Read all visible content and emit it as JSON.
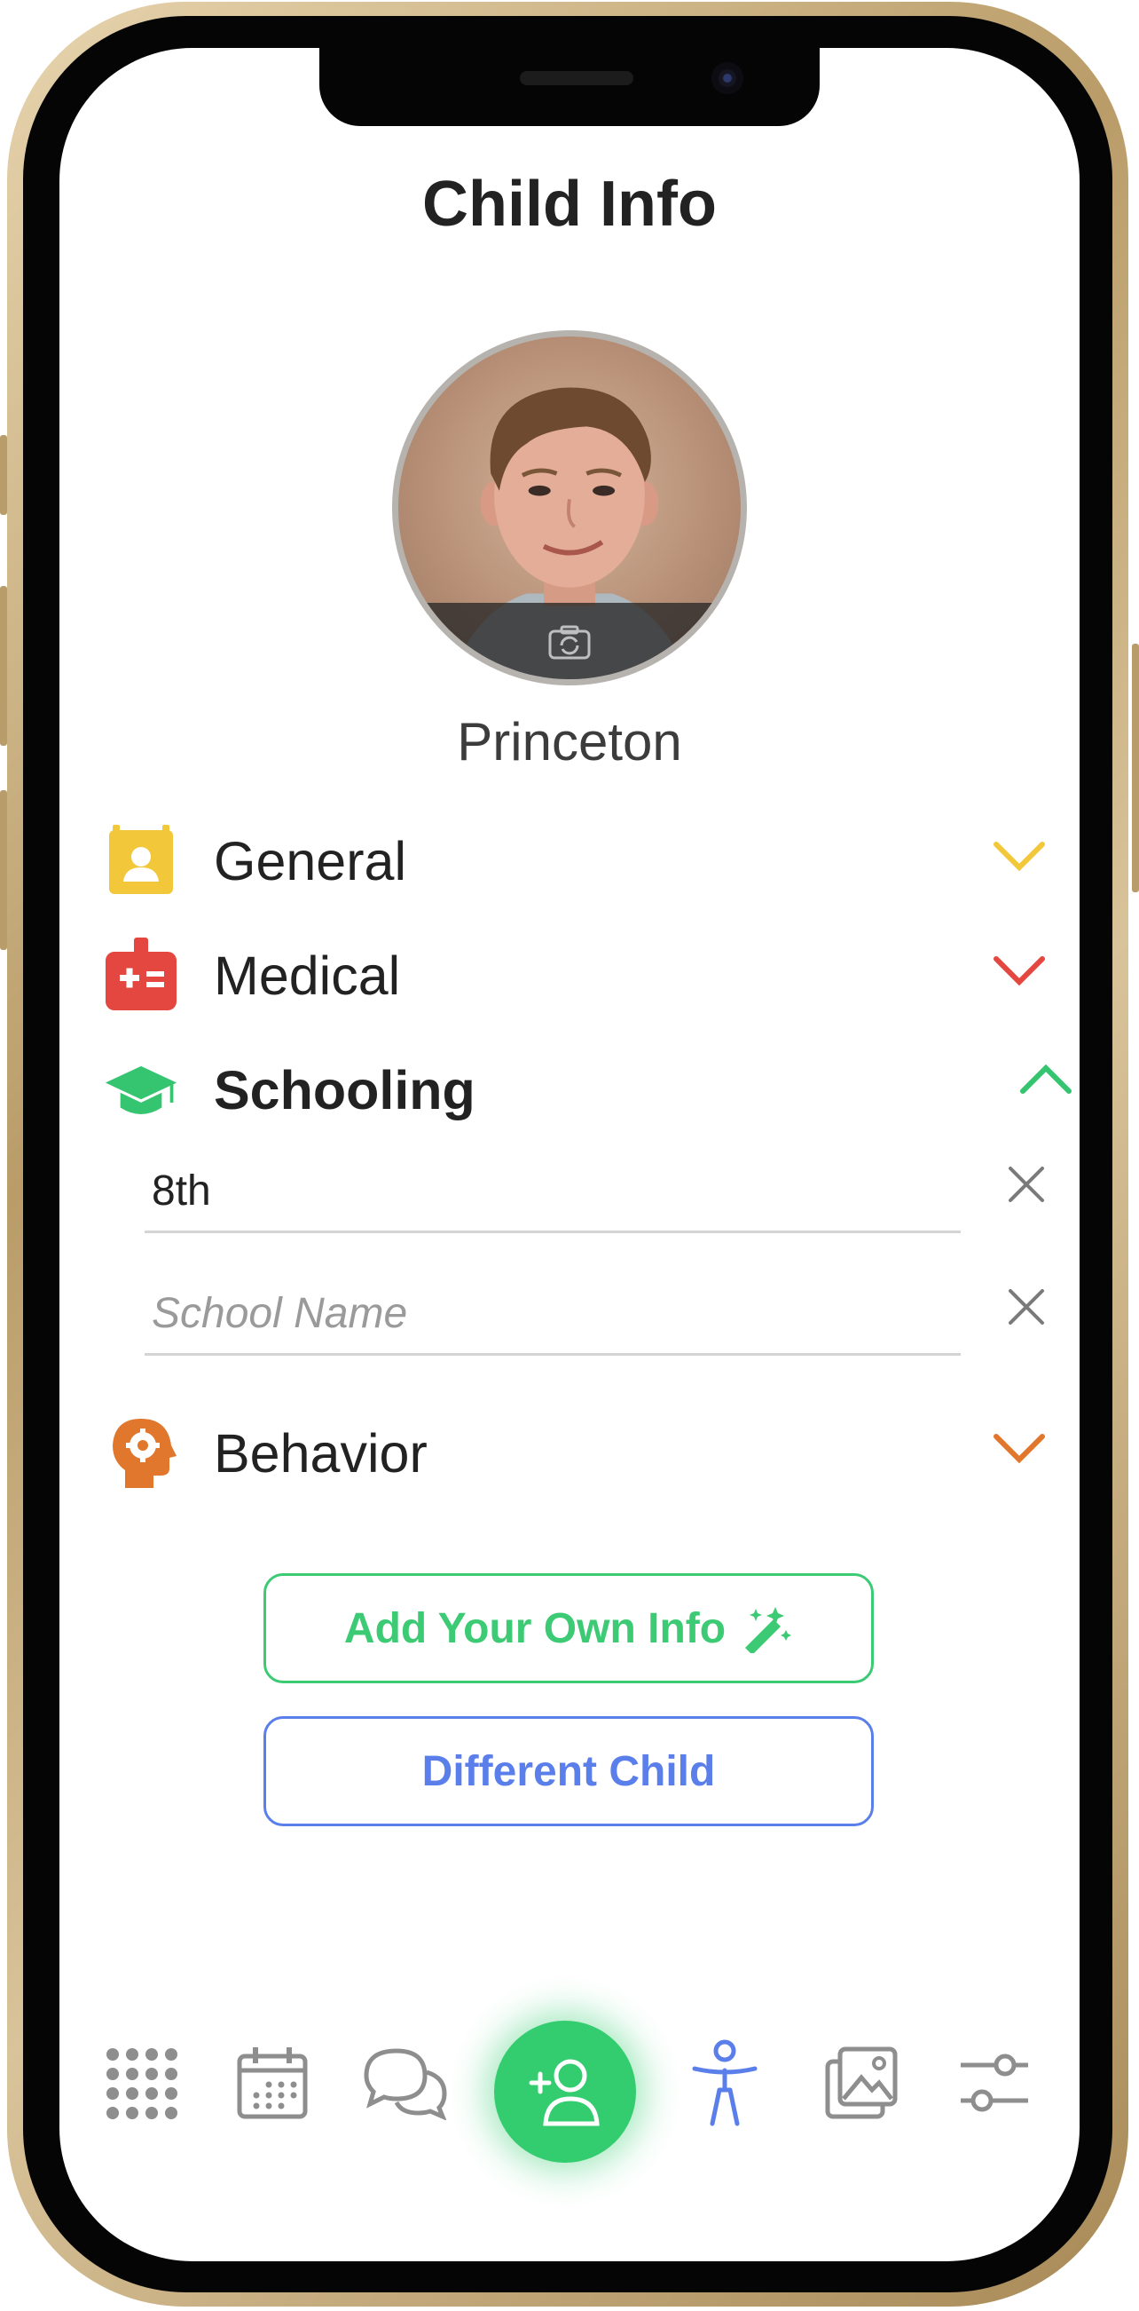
{
  "page": {
    "title": "Child Info"
  },
  "child": {
    "name": "Princeton"
  },
  "sections": {
    "general": {
      "label": "General",
      "color": "#f2c83a"
    },
    "medical": {
      "label": "Medical",
      "color": "#e3473f"
    },
    "schooling": {
      "label": "Schooling",
      "color": "#35c46f",
      "expanded": true,
      "grade_value": "8th",
      "school_placeholder": "School Name"
    },
    "behavior": {
      "label": "Behavior",
      "color": "#e0772c"
    }
  },
  "buttons": {
    "add_info": "Add Your Own Info",
    "different_child": "Different Child"
  },
  "nav": {
    "items": [
      "apps-grid-icon",
      "calendar-icon",
      "chat-icon",
      "add-person-icon",
      "child-icon",
      "gallery-icon",
      "settings-sliders-icon"
    ],
    "active": "child-icon",
    "active_color": "#5b7fea",
    "fab_color": "#33cc6e"
  }
}
